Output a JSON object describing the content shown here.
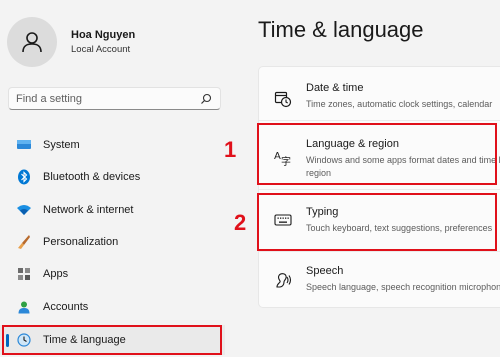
{
  "user": {
    "name": "Hoa Nguyen",
    "account_type": "Local Account",
    "avatar_icon": "person-icon"
  },
  "search": {
    "placeholder": "Find a setting",
    "icon": "search-icon"
  },
  "nav": {
    "items": [
      {
        "label": "System",
        "icon": "monitor-icon"
      },
      {
        "label": "Bluetooth & devices",
        "icon": "bluetooth-icon"
      },
      {
        "label": "Network & internet",
        "icon": "wifi-icon"
      },
      {
        "label": "Personalization",
        "icon": "brush-icon"
      },
      {
        "label": "Apps",
        "icon": "apps-icon"
      },
      {
        "label": "Accounts",
        "icon": "accounts-icon"
      },
      {
        "label": "Time & language",
        "icon": "clock-globe-icon",
        "active": true
      }
    ]
  },
  "main": {
    "title": "Time & language",
    "cards": [
      {
        "title": "Date & time",
        "description": "Time zones, automatic clock settings, calendar",
        "icon": "date-time-icon"
      },
      {
        "title": "Language & region",
        "description_line1": "Windows and some apps format dates and time based on your",
        "description_line2": "region",
        "icon": "language-icon"
      },
      {
        "title": "Typing",
        "description": "Touch keyboard, text suggestions, preferences",
        "icon": "keyboard-icon"
      },
      {
        "title": "Speech",
        "description": "Speech language, speech recognition microphone",
        "icon": "speech-icon"
      }
    ]
  },
  "annotations": {
    "marker_1": "1",
    "marker_2": "2",
    "color": "#e0101a"
  },
  "colors": {
    "accent": "#0067c0",
    "background": "#f3f3f3",
    "card": "#fbfbfb"
  }
}
